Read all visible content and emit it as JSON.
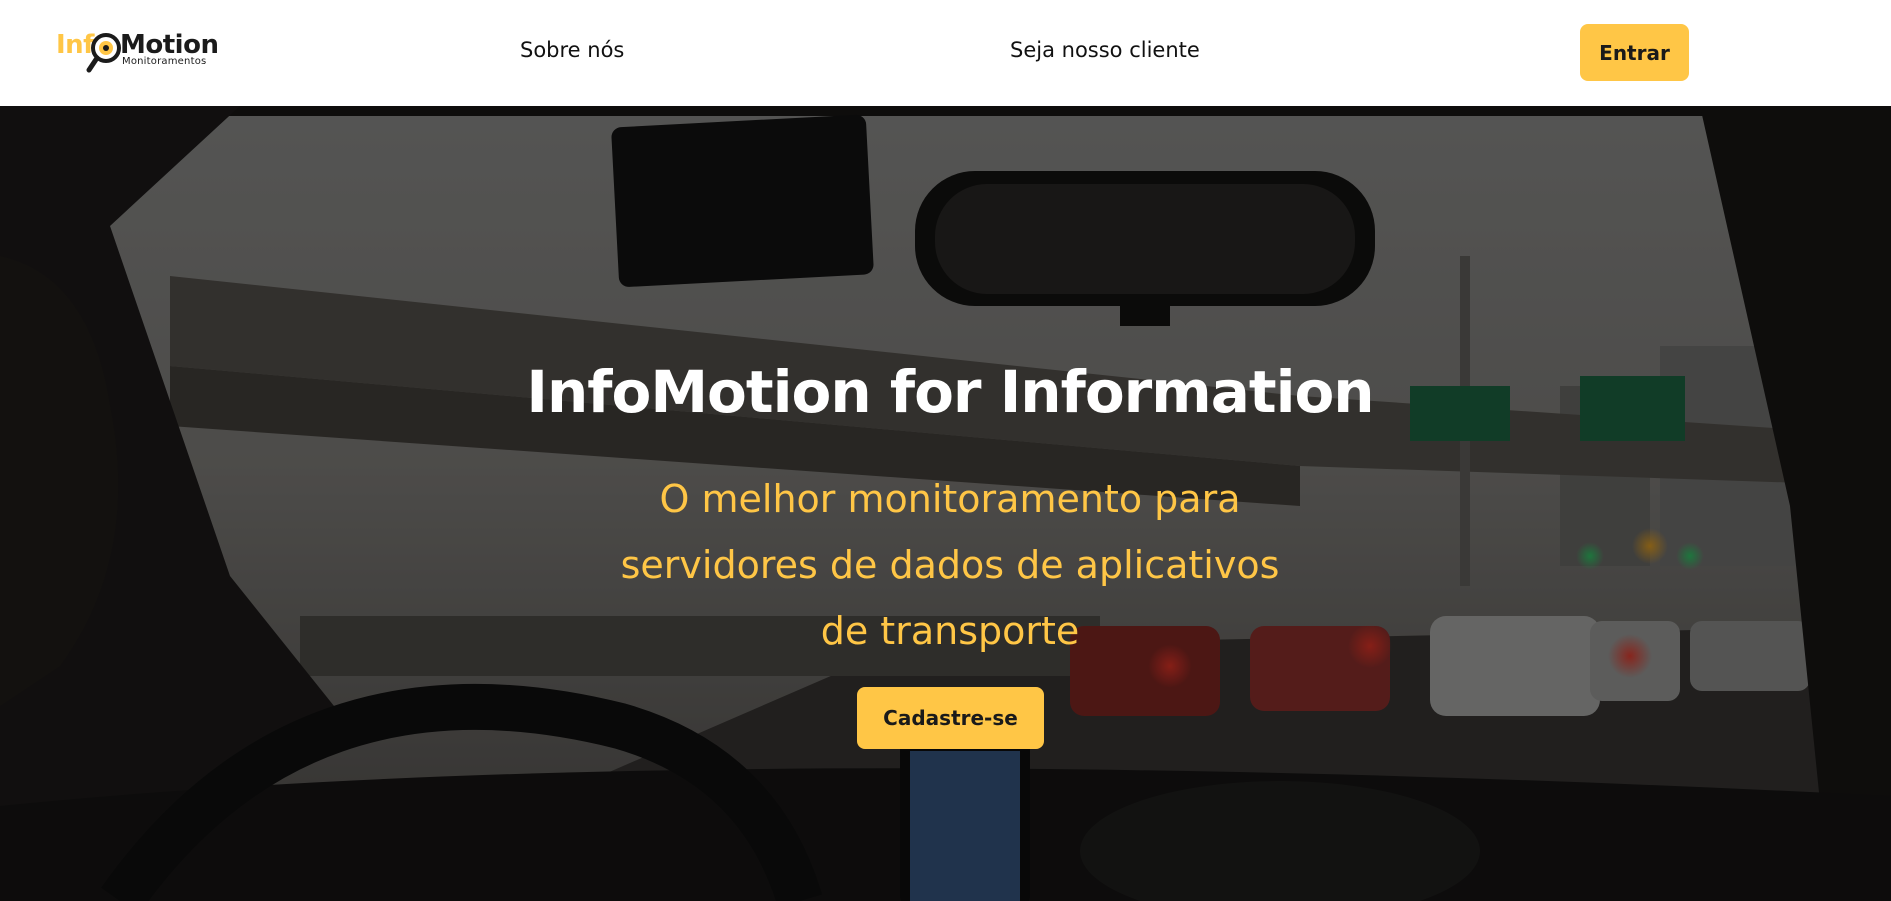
{
  "brand": {
    "name_part1": "Inf",
    "name_part2": "Motion",
    "tagline": "Monitoramentos"
  },
  "nav": {
    "items": [
      {
        "label": "Sobre nós"
      },
      {
        "label": "Seja nosso cliente"
      }
    ],
    "login_label": "Entrar"
  },
  "hero": {
    "title": "InfoMotion for Information",
    "subtitle_lines": [
      "O melhor monitoramento para",
      "servidores de dados de aplicativos",
      "de transporte"
    ],
    "cta_label": "Cadastre-se"
  },
  "colors": {
    "accent": "#ffc646",
    "nav_background": "#ffffff",
    "text_dark": "#1a1a1a",
    "hero_title": "#ffffff"
  }
}
